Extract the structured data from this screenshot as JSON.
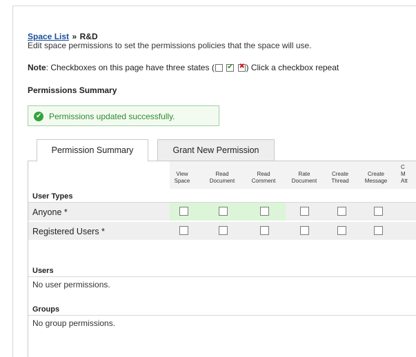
{
  "breadcrumb": {
    "link": "Space List",
    "separator": "»",
    "current": "R&D"
  },
  "description": "Edit space permissions to set the permissions policies that the space will use.",
  "note": {
    "label": "Note",
    "text_before": ": Checkboxes on this page have three states (",
    "text_after": ") Click a checkbox repeat"
  },
  "summary_title": "Permissions Summary",
  "success_message": "Permissions updated successfully.",
  "tabs": [
    {
      "label": "Permission Summary",
      "active": true
    },
    {
      "label": "Grant New Permission",
      "active": false
    }
  ],
  "columns": [
    {
      "line1": "View",
      "line2": "Space"
    },
    {
      "line1": "Read",
      "line2": "Document"
    },
    {
      "line1": "Read",
      "line2": "Comment"
    },
    {
      "line1": "Rate",
      "line2": "Document"
    },
    {
      "line1": "Create",
      "line2": "Thread"
    },
    {
      "line1": "Create",
      "line2": "Message"
    },
    {
      "line1": "C",
      "line2": "M",
      "line3": "Att"
    }
  ],
  "user_types": {
    "heading": "User Types",
    "rows": [
      {
        "label": "Anyone *"
      },
      {
        "label": "Registered Users *"
      }
    ]
  },
  "users": {
    "heading": "Users",
    "empty": "No user permissions."
  },
  "groups": {
    "heading": "Groups",
    "empty": "No group permissions."
  },
  "colors": {
    "link": "#1a4e9c",
    "success_text": "#2d8b2d",
    "highlight": "#dcf5d8"
  }
}
